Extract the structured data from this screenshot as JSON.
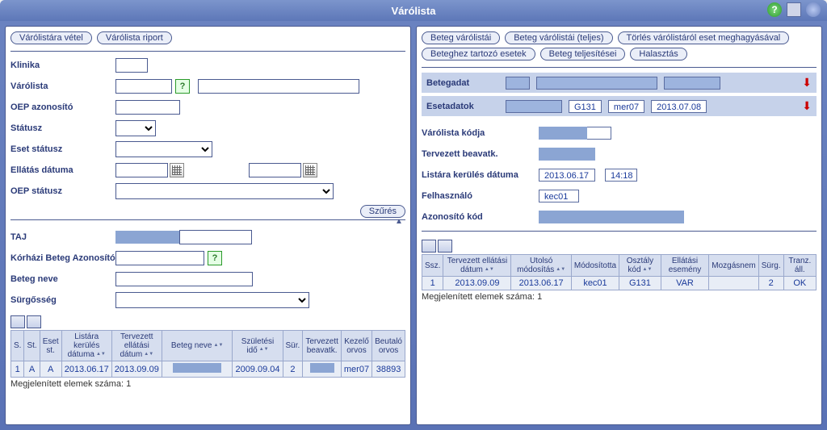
{
  "window": {
    "title": "Várólista"
  },
  "left": {
    "buttons": {
      "enlist": "Várólistára vétel",
      "report": "Várólista riport"
    },
    "labels": {
      "klinika": "Klinika",
      "varolista": "Várólista",
      "oep_id": "OEP azonosító",
      "status": "Státusz",
      "case_status": "Eset státusz",
      "care_date": "Ellátás dátuma",
      "oep_status": "OEP státusz",
      "filter": "Szűrés",
      "taj": "TAJ",
      "korhaz_id": "Kórházi Beteg Azonosító",
      "patient_name": "Beteg neve",
      "urgency": "Sürgősség"
    },
    "table": {
      "headers": [
        "S.",
        "St.",
        "Eset st.",
        "Listára kerülés dátuma",
        "Tervezett ellátási dátum",
        "Beteg neve",
        "Születési idő",
        "Sür.",
        "Tervezett beavatk.",
        "Kezelő orvos",
        "Beutaló orvos"
      ],
      "row": {
        "s": "1",
        "st": "A",
        "eset_st": "A",
        "list_date": "2013.06.17",
        "plan_date": "2013.09.09",
        "name": "",
        "birth": "2009.09.04",
        "urgency": "2",
        "proc": "",
        "doctor": "mer07",
        "ref_doctor": "38893"
      },
      "count_label": "Megjelenített elemek száma: 1"
    }
  },
  "right": {
    "buttons": {
      "patient_lists": "Beteg várólistái",
      "patient_lists_full": "Beteg várólistái (teljes)",
      "delete_keep": "Törlés várólistáról eset meghagyásával",
      "patient_cases": "Beteghez tartozó esetek",
      "patient_perf": "Beteg teljesítései",
      "postpone": "Halasztás"
    },
    "bands": {
      "patient": {
        "label": "Betegadat"
      },
      "case": {
        "label": "Esetadatok",
        "dept": "G131",
        "user": "mer07",
        "date": "2013.07.08"
      }
    },
    "details": {
      "labels": {
        "list_code": "Várólista kódja",
        "planned_proc": "Tervezett beavatk.",
        "list_date": "Listára kerülés dátuma",
        "user": "Felhasználó",
        "id_code": "Azonosító kód"
      },
      "list_date": "2013.06.17",
      "list_time": "14:18",
      "user": "kec01"
    },
    "table": {
      "headers": [
        "Ssz.",
        "Tervezett ellátási dátum",
        "Utolsó módosítás",
        "Módosította",
        "Osztály kód",
        "Ellátási esemény",
        "Mozgásnem",
        "Sürg.",
        "Tranz. áll."
      ],
      "row": {
        "no": "1",
        "plan_date": "2013.09.09",
        "last_mod": "2013.06.17",
        "mod_by": "kec01",
        "dept": "G131",
        "event": "VAR",
        "movement": "",
        "urgency": "2",
        "trans": "OK"
      },
      "count_label": "Megjelenített elemek száma: 1"
    }
  }
}
